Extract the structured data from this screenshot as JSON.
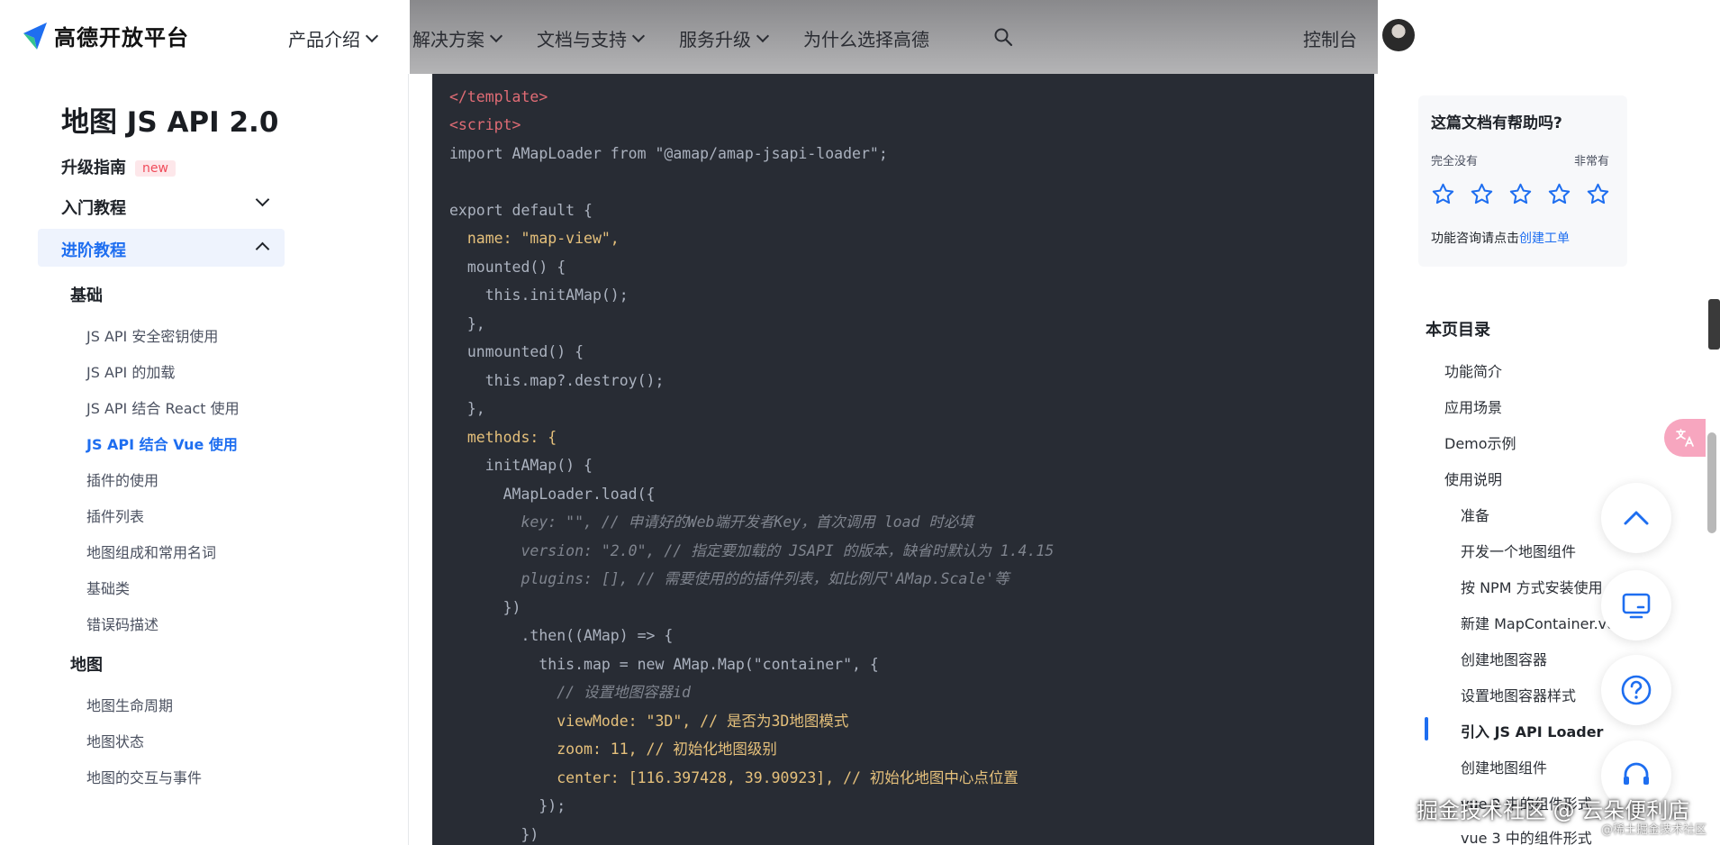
{
  "header": {
    "brand": "高德开放平台",
    "nav": [
      "产品介绍",
      "解决方案",
      "文档与支持",
      "服务升级",
      "为什么选择高德"
    ],
    "console": "控制台"
  },
  "sidebar": {
    "doc_title": "地图 JS API 2.0",
    "upgrade": "升级指南",
    "new_badge": "new",
    "intro": "入门教程",
    "advanced": "进阶教程",
    "group_basic": "基础",
    "basic_items": [
      "JS API 安全密钥使用",
      "JS API 的加载",
      "JS API 结合 React 使用",
      "JS API 结合 Vue 使用",
      "插件的使用",
      "插件列表",
      "地图组成和常用名词",
      "基础类",
      "错误码描述"
    ],
    "group_map": "地图",
    "map_items": [
      "地图生命周期",
      "地图状态",
      "地图的交互与事件"
    ]
  },
  "code": {
    "lines": [
      "</template>",
      "<script>",
      "import AMapLoader from \"@amap/amap-jsapi-loader\";",
      "",
      "export default {",
      "  name: \"map-view\",",
      "  mounted() {",
      "    this.initAMap();",
      "  },",
      "  unmounted() {",
      "    this.map?.destroy();",
      "  },",
      "  methods: {",
      "    initAMap() {",
      "      AMapLoader.load({",
      "        key: \"\", // 申请好的Web端开发者Key，首次调用 load 时必填",
      "        version: \"2.0\", // 指定要加载的 JSAPI 的版本，缺省时默认为 1.4.15",
      "        plugins: [], // 需要使用的的插件列表，如比例尺'AMap.Scale'等",
      "      })",
      "        .then((AMap) => {",
      "          this.map = new AMap.Map(\"container\", {",
      "            // 设置地图容器id",
      "            viewMode: \"3D\", // 是否为3D地图模式",
      "            zoom: 11, // 初始化地图级别",
      "            center: [116.397428, 39.90923], // 初始化地图中心点位置",
      "          });",
      "        })"
    ]
  },
  "feedback": {
    "title": "这篇文档有帮助吗?",
    "low": "完全没有",
    "high": "非常有",
    "consult_prefix": "功能咨询请点击",
    "consult_link": "创建工单",
    "star_color": "#1e6ef0"
  },
  "toc": {
    "title": "本页目录",
    "items": [
      "功能简介",
      "应用场景",
      "Demo示例",
      "使用说明"
    ],
    "sub_items": [
      "准备",
      "开发一个地图组件",
      "按 NPM 方式安装使用",
      "新建 MapContainer.vue",
      "创建地图容器",
      "设置地图容器样式",
      "引入 JS API Loader",
      "创建地图组件",
      "vue 2 中的组件形式",
      "vue 3 中的组件形式"
    ],
    "active": "引入 JS API Loader"
  },
  "watermark": {
    "main": "掘金技术社区 @ 云朵便利店",
    "sub": "@稀土掘金技术社区"
  },
  "colors": {
    "accent": "#1e6ef0",
    "code_bg": "#282c34"
  }
}
